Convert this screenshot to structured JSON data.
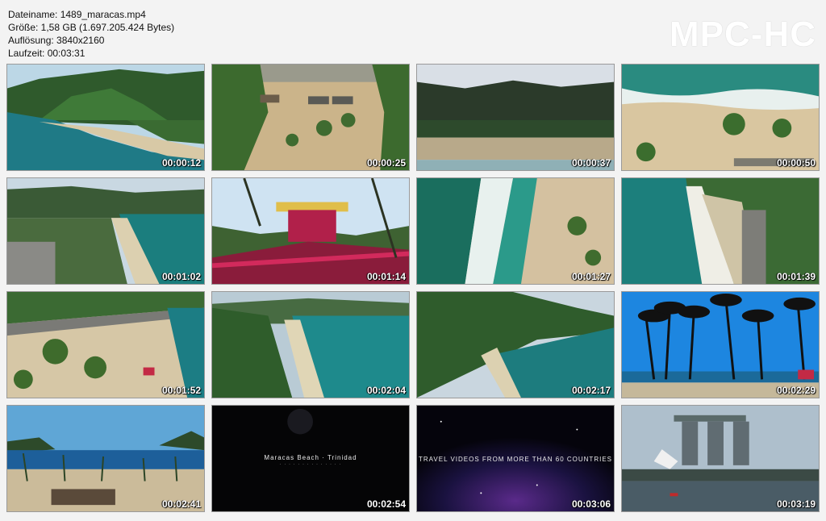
{
  "info": {
    "filename": "Dateiname: 1489_maracas.mp4",
    "size": "Größe: 1,58 GB (1.697.205.424 Bytes)",
    "resolution": "Auflösung: 3840x2160",
    "duration": "Laufzeit: 00:03:31"
  },
  "logo": "MPC-HC",
  "thumbs": [
    {
      "time": "00:00:12",
      "scene": "coast-hills"
    },
    {
      "time": "00:00:25",
      "scene": "beach-topdown"
    },
    {
      "time": "00:00:37",
      "scene": "palm-beach-wide"
    },
    {
      "time": "00:00:50",
      "scene": "surf-topdown"
    },
    {
      "time": "00:01:02",
      "scene": "bay-aerial"
    },
    {
      "time": "00:01:14",
      "scene": "lifeguard-tower"
    },
    {
      "time": "00:01:27",
      "scene": "waves-sand"
    },
    {
      "time": "00:01:39",
      "scene": "bay-curve"
    },
    {
      "time": "00:01:52",
      "scene": "beach-palms"
    },
    {
      "time": "00:02:04",
      "scene": "bay-green"
    },
    {
      "time": "00:02:17",
      "scene": "bay-mountain"
    },
    {
      "time": "00:02:29",
      "scene": "palms-blue-sky"
    },
    {
      "time": "00:02:41",
      "scene": "beach-lagoon"
    },
    {
      "time": "00:02:54",
      "scene": "dark-title",
      "caption": "Maracas Beach · Trinidad",
      "subcaption": "· · · · · · · · · · · · · ·"
    },
    {
      "time": "00:03:06",
      "scene": "space-title",
      "caption": "TRAVEL VIDEOS FROM MORE THAN 60 COUNTRIES"
    },
    {
      "time": "00:03:19",
      "scene": "marina-bay"
    }
  ]
}
